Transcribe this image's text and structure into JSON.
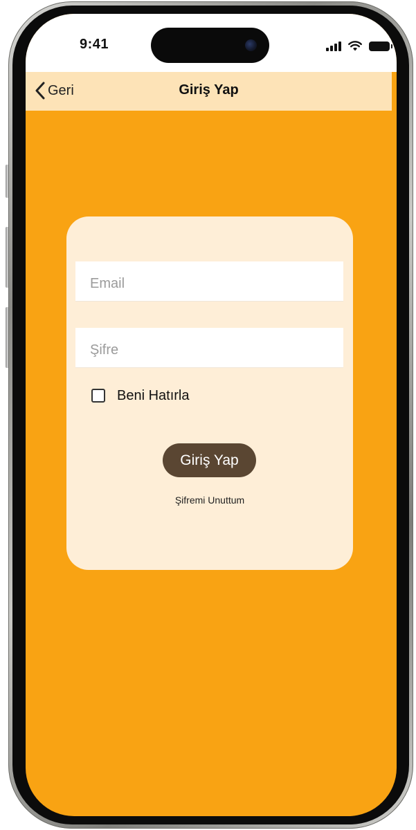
{
  "status_bar": {
    "time": "9:41"
  },
  "nav": {
    "back_label": "Geri",
    "title": "Giriş Yap"
  },
  "login_form": {
    "email_placeholder": "Email",
    "password_placeholder": "Şifre",
    "remember_label": "Beni Hatırla",
    "remember_checked": false,
    "submit_label": "Giriş Yap",
    "forgot_label": "Şifremi Unuttum"
  },
  "colors": {
    "screen_background": "#f9a313",
    "nav_background": "#fde3b7",
    "card_background": "#feeed7",
    "button_background": "#5a4632",
    "button_text": "#ffffff"
  },
  "icons": {
    "back": "chevron-left-icon",
    "signal": "cellular-signal-icon",
    "wifi": "wifi-icon",
    "battery": "battery-icon"
  }
}
